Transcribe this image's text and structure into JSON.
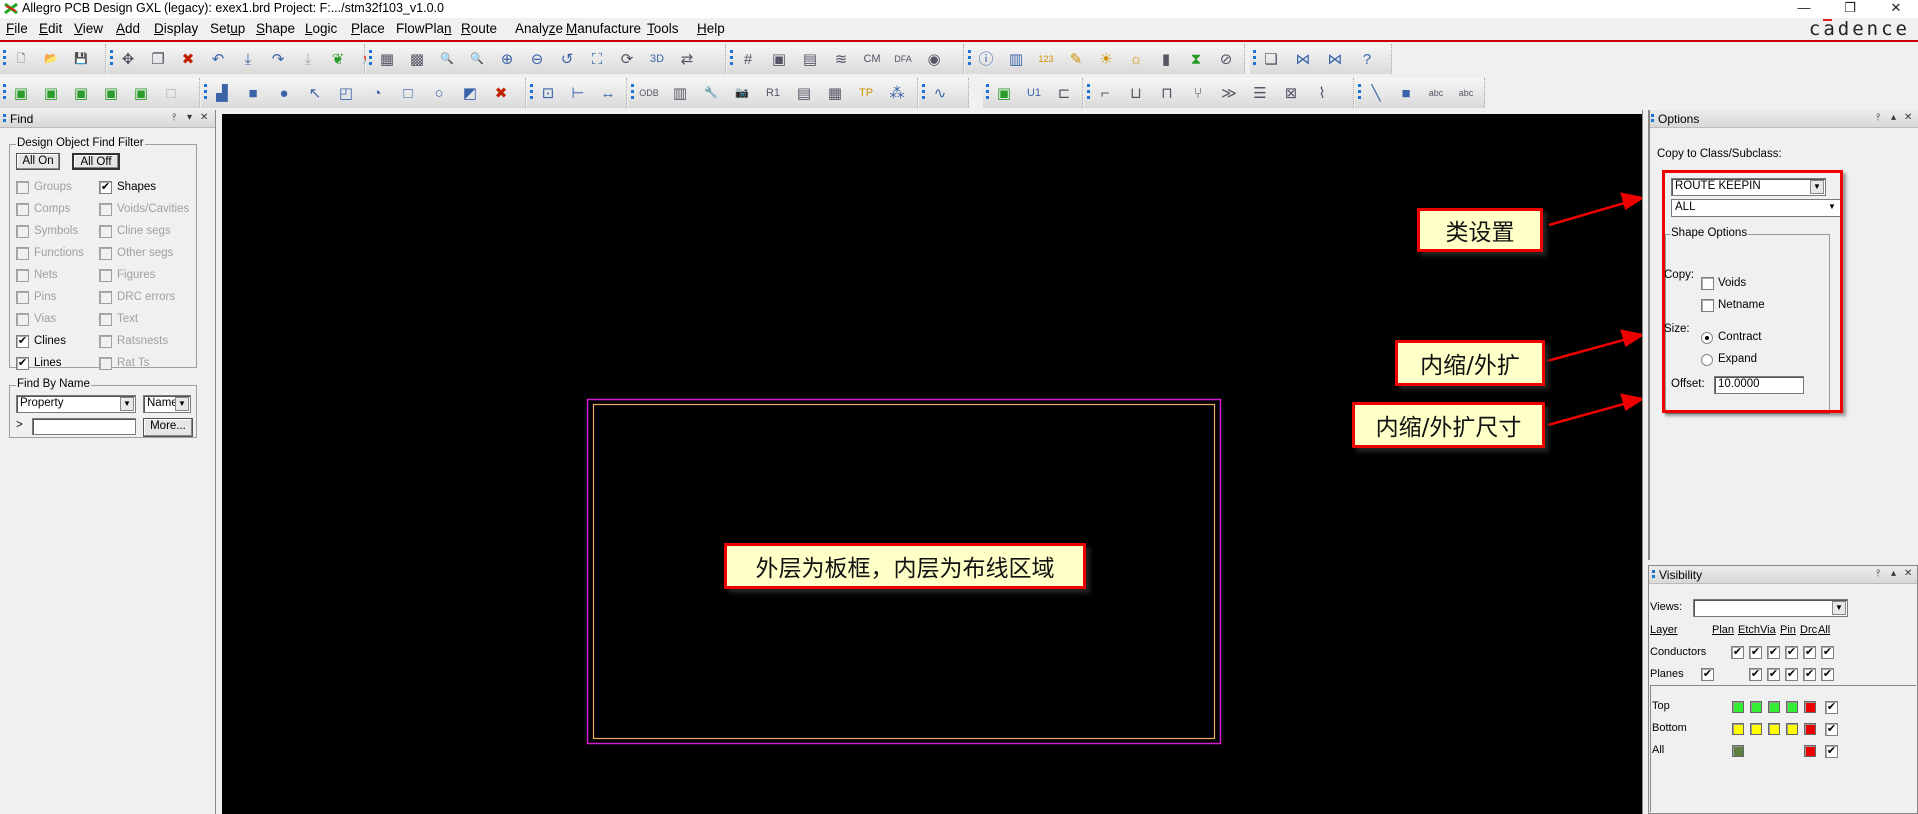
{
  "window": {
    "title": "Allegro PCB Design GXL (legacy): exex1.brd  Project: F:.../stm32f103_v1.0.0",
    "brand": "cadence",
    "controls": {
      "minimize": "—",
      "restore": "❐",
      "close": "✕"
    }
  },
  "menu": [
    {
      "label": "File",
      "mnemonic": "F"
    },
    {
      "label": "Edit",
      "mnemonic": "E"
    },
    {
      "label": "View",
      "mnemonic": "V"
    },
    {
      "label": "Add",
      "mnemonic": "A"
    },
    {
      "label": "Display",
      "mnemonic": "D"
    },
    {
      "label": "Setup",
      "mnemonic": "u"
    },
    {
      "label": "Shape",
      "mnemonic": "S"
    },
    {
      "label": "Logic",
      "mnemonic": "L"
    },
    {
      "label": "Place",
      "mnemonic": "P"
    },
    {
      "label": "FlowPlan",
      "mnemonic": "n"
    },
    {
      "label": "Route",
      "mnemonic": "R"
    },
    {
      "label": "Analyze",
      "mnemonic": "z"
    },
    {
      "label": "Manufacture",
      "mnemonic": "M"
    },
    {
      "label": "Tools",
      "mnemonic": "T"
    },
    {
      "label": "Help",
      "mnemonic": "H"
    }
  ],
  "toolbar1": [
    {
      "icon": "new-file-icon",
      "glyph": "🗋"
    },
    {
      "icon": "open-folder-icon",
      "glyph": "📂"
    },
    {
      "icon": "save-icon",
      "glyph": "💾"
    },
    {
      "icon": "move-icon",
      "glyph": "✥"
    },
    {
      "icon": "copy-icon",
      "glyph": "❐"
    },
    {
      "icon": "delete-icon",
      "glyph": "✖"
    },
    {
      "icon": "undo-icon",
      "glyph": "↶"
    },
    {
      "icon": "undo-down-icon",
      "glyph": "⤓"
    },
    {
      "icon": "redo-icon",
      "glyph": "↷"
    },
    {
      "icon": "redo-down-icon",
      "glyph": "⤓"
    },
    {
      "icon": "leaf-icon",
      "glyph": "❦"
    },
    {
      "icon": "pin-icon",
      "glyph": "📌"
    },
    {
      "icon": "unrats-all-icon",
      "glyph": "▦"
    },
    {
      "icon": "rats-all-icon",
      "glyph": "▩"
    },
    {
      "icon": "zoom-fit-icon",
      "glyph": "🔍"
    },
    {
      "icon": "zoom-window-icon",
      "glyph": "🔍"
    },
    {
      "icon": "zoom-in-icon",
      "glyph": "⊕"
    },
    {
      "icon": "zoom-out-icon",
      "glyph": "⊖"
    },
    {
      "icon": "zoom-previous-icon",
      "glyph": "↺"
    },
    {
      "icon": "zoom-world-icon",
      "glyph": "⛶"
    },
    {
      "icon": "redraw-icon",
      "glyph": "⟳"
    },
    {
      "icon": "3d-view-icon",
      "glyph": "3D"
    },
    {
      "icon": "flip-board-icon",
      "glyph": "⇄"
    },
    {
      "icon": "grid-toggle-icon",
      "glyph": "#"
    },
    {
      "icon": "color-icon",
      "glyph": "▣"
    },
    {
      "icon": "shadow-icon",
      "glyph": "▤"
    },
    {
      "icon": "layer-priority-icon",
      "glyph": "≋"
    },
    {
      "icon": "constraint-manager-icon",
      "glyph": "CM"
    },
    {
      "icon": "dfa-icon",
      "glyph": "DFA"
    },
    {
      "icon": "world-view-icon",
      "glyph": "◉"
    },
    {
      "icon": "info-icon",
      "glyph": "ⓘ"
    },
    {
      "icon": "element-info-icon",
      "glyph": "▥"
    },
    {
      "icon": "measure-icon",
      "glyph": "123"
    },
    {
      "icon": "highlight-icon",
      "glyph": "✎"
    },
    {
      "icon": "highlight-sun-icon",
      "glyph": "☀"
    },
    {
      "icon": "dehighlight-icon",
      "glyph": "☼"
    },
    {
      "icon": "bar-chart-icon",
      "glyph": "▮"
    },
    {
      "icon": "hourglass-icon",
      "glyph": "⧗"
    },
    {
      "icon": "no-select-icon",
      "glyph": "⊘"
    },
    {
      "icon": "window-stack-icon",
      "glyph": "❏"
    },
    {
      "icon": "bowtie-icon",
      "glyph": "⋈"
    },
    {
      "icon": "bowtie-window-icon",
      "glyph": "⋈"
    },
    {
      "icon": "help-icon",
      "glyph": "?"
    }
  ],
  "toolbar2": [
    {
      "icon": "place-manual-icon",
      "glyph": "▣"
    },
    {
      "icon": "place-component-icon",
      "glyph": "▣"
    },
    {
      "icon": "place-swap-icon",
      "glyph": "▣"
    },
    {
      "icon": "place-replicate-icon",
      "glyph": "▣"
    },
    {
      "icon": "place-matrix-icon",
      "glyph": "▣"
    },
    {
      "icon": "place-disabled-icon",
      "glyph": "□"
    },
    {
      "icon": "shape-polygon-icon",
      "glyph": "▟"
    },
    {
      "icon": "shape-rectangle-icon",
      "glyph": "■"
    },
    {
      "icon": "shape-circle-icon",
      "glyph": "●"
    },
    {
      "icon": "shape-select-icon",
      "glyph": "↖"
    },
    {
      "icon": "shape-manual-void-icon",
      "glyph": "◰"
    },
    {
      "icon": "shape-void-circle-icon",
      "glyph": "◔"
    },
    {
      "icon": "shape-void-rect-icon",
      "glyph": "□"
    },
    {
      "icon": "shape-void-element-icon",
      "glyph": "○"
    },
    {
      "icon": "shape-edit-boundary-icon",
      "glyph": "◩"
    },
    {
      "icon": "shape-delete-islands-icon",
      "glyph": "✖"
    },
    {
      "icon": "dimension-icon",
      "glyph": "⊡"
    },
    {
      "icon": "dimension-linear-icon",
      "glyph": "⊢"
    },
    {
      "icon": "dimension-width-icon",
      "glyph": "↔"
    },
    {
      "icon": "odb-export-icon",
      "glyph": "ODB"
    },
    {
      "icon": "artwork-icon",
      "glyph": "▥"
    },
    {
      "icon": "tool-wrench-icon",
      "glyph": "🔧"
    },
    {
      "icon": "camera-icon",
      "glyph": "📷"
    },
    {
      "icon": "rename-refdes-icon",
      "glyph": "R1"
    },
    {
      "icon": "report-icon",
      "glyph": "▤"
    },
    {
      "icon": "drill-table-icon",
      "glyph": "▦"
    },
    {
      "icon": "testprep-icon",
      "glyph": "TP"
    },
    {
      "icon": "array-icon",
      "glyph": "⁂"
    },
    {
      "icon": "waveform-icon",
      "glyph": "∿"
    },
    {
      "icon": "component-swap-icon",
      "glyph": "▣"
    },
    {
      "icon": "chip-icon",
      "glyph": "U1"
    },
    {
      "icon": "connector-icon",
      "glyph": "⊏"
    },
    {
      "icon": "add-connect-icon",
      "glyph": "⌐"
    },
    {
      "icon": "slide-icon",
      "glyph": "⊔"
    },
    {
      "icon": "delay-tune-icon",
      "glyph": "⊓"
    },
    {
      "icon": "fanout-icon",
      "glyph": "⑂"
    },
    {
      "icon": "bus-route-icon",
      "glyph": "≫"
    },
    {
      "icon": "multi-route-icon",
      "glyph": "☰"
    },
    {
      "icon": "auto-router-icon",
      "glyph": "⊠"
    },
    {
      "icon": "accordion-icon",
      "glyph": "⌇"
    },
    {
      "icon": "add-line-icon",
      "glyph": "╲"
    },
    {
      "icon": "add-rect-icon",
      "glyph": "■"
    },
    {
      "icon": "add-text-icon",
      "glyph": "abc"
    },
    {
      "icon": "edit-text-icon",
      "glyph": "abc"
    }
  ],
  "find_panel": {
    "title": "Find",
    "filter_group": "Design Object Find Filter",
    "all_on": "All On",
    "all_off": "All Off",
    "objects": [
      {
        "label": "Groups",
        "checked": false,
        "enabled": false
      },
      {
        "label": "Shapes",
        "checked": true,
        "enabled": true
      },
      {
        "label": "Comps",
        "checked": false,
        "enabled": false
      },
      {
        "label": "Voids/Cavities",
        "checked": false,
        "enabled": false
      },
      {
        "label": "Symbols",
        "checked": false,
        "enabled": false
      },
      {
        "label": "Cline segs",
        "checked": false,
        "enabled": false
      },
      {
        "label": "Functions",
        "checked": false,
        "enabled": false
      },
      {
        "label": "Other segs",
        "checked": false,
        "enabled": false
      },
      {
        "label": "Nets",
        "checked": false,
        "enabled": false
      },
      {
        "label": "Figures",
        "checked": false,
        "enabled": false
      },
      {
        "label": "Pins",
        "checked": false,
        "enabled": false
      },
      {
        "label": "DRC errors",
        "checked": false,
        "enabled": false
      },
      {
        "label": "Vias",
        "checked": false,
        "enabled": false
      },
      {
        "label": "Text",
        "checked": false,
        "enabled": false
      },
      {
        "label": "Clines",
        "checked": true,
        "enabled": true
      },
      {
        "label": "Ratsnests",
        "checked": false,
        "enabled": false
      },
      {
        "label": "Lines",
        "checked": true,
        "enabled": true
      },
      {
        "label": "Rat Ts",
        "checked": false,
        "enabled": false
      }
    ],
    "find_by_name": {
      "group": "Find By Name",
      "type_value": "Property",
      "mode_value": "Name",
      "prompt": ">",
      "input_value": "",
      "more": "More..."
    }
  },
  "options_panel": {
    "title": "Options",
    "copy_to_label": "Copy to Class/Subclass:",
    "class_value": "ROUTE KEEPIN",
    "subclass_value": "ALL",
    "shape_options": "Shape Options",
    "copy_label": "Copy:",
    "voids": {
      "label": "Voids",
      "checked": false
    },
    "netname": {
      "label": "Netname",
      "checked": false
    },
    "size_label": "Size:",
    "contract": {
      "label": "Contract",
      "selected": true
    },
    "expand": {
      "label": "Expand",
      "selected": false
    },
    "offset_label": "Offset:",
    "offset_value": "10.0000"
  },
  "visibility_panel": {
    "title": "Visibility",
    "views_label": "Views:",
    "views_value": "",
    "headers": [
      "Layer",
      "Plan",
      "Etch",
      "Via",
      "Pin",
      "Drc",
      "All"
    ],
    "conductors_label": "Conductors",
    "planes_label": "Planes",
    "layers": [
      {
        "name": "Top",
        "colors": [
          "#33ee33",
          "#33ee33",
          "#33ee33",
          "#33ee33",
          "#ee0000"
        ],
        "all": true
      },
      {
        "name": "Bottom",
        "colors": [
          "#ffff00",
          "#ffff00",
          "#ffff00",
          "#ffff00",
          "#ee0000"
        ],
        "all": true
      },
      {
        "name": "All",
        "colors": [
          "#5f8040",
          null,
          null,
          null,
          "#ee0000"
        ],
        "all": true
      }
    ]
  },
  "annotations": {
    "class_setting": "类设置",
    "contract_expand": "内缩/外扩",
    "contract_expand_size": "内缩/外扩尺寸",
    "board_note": "外层为板框，内层为布线区域"
  },
  "colors": {
    "board_outline": "#d020d0",
    "route_keepin": "#f0a860",
    "annotation_red": "#ee0000",
    "annotation_fill": "#ffffc8",
    "canvas": "#000000"
  }
}
